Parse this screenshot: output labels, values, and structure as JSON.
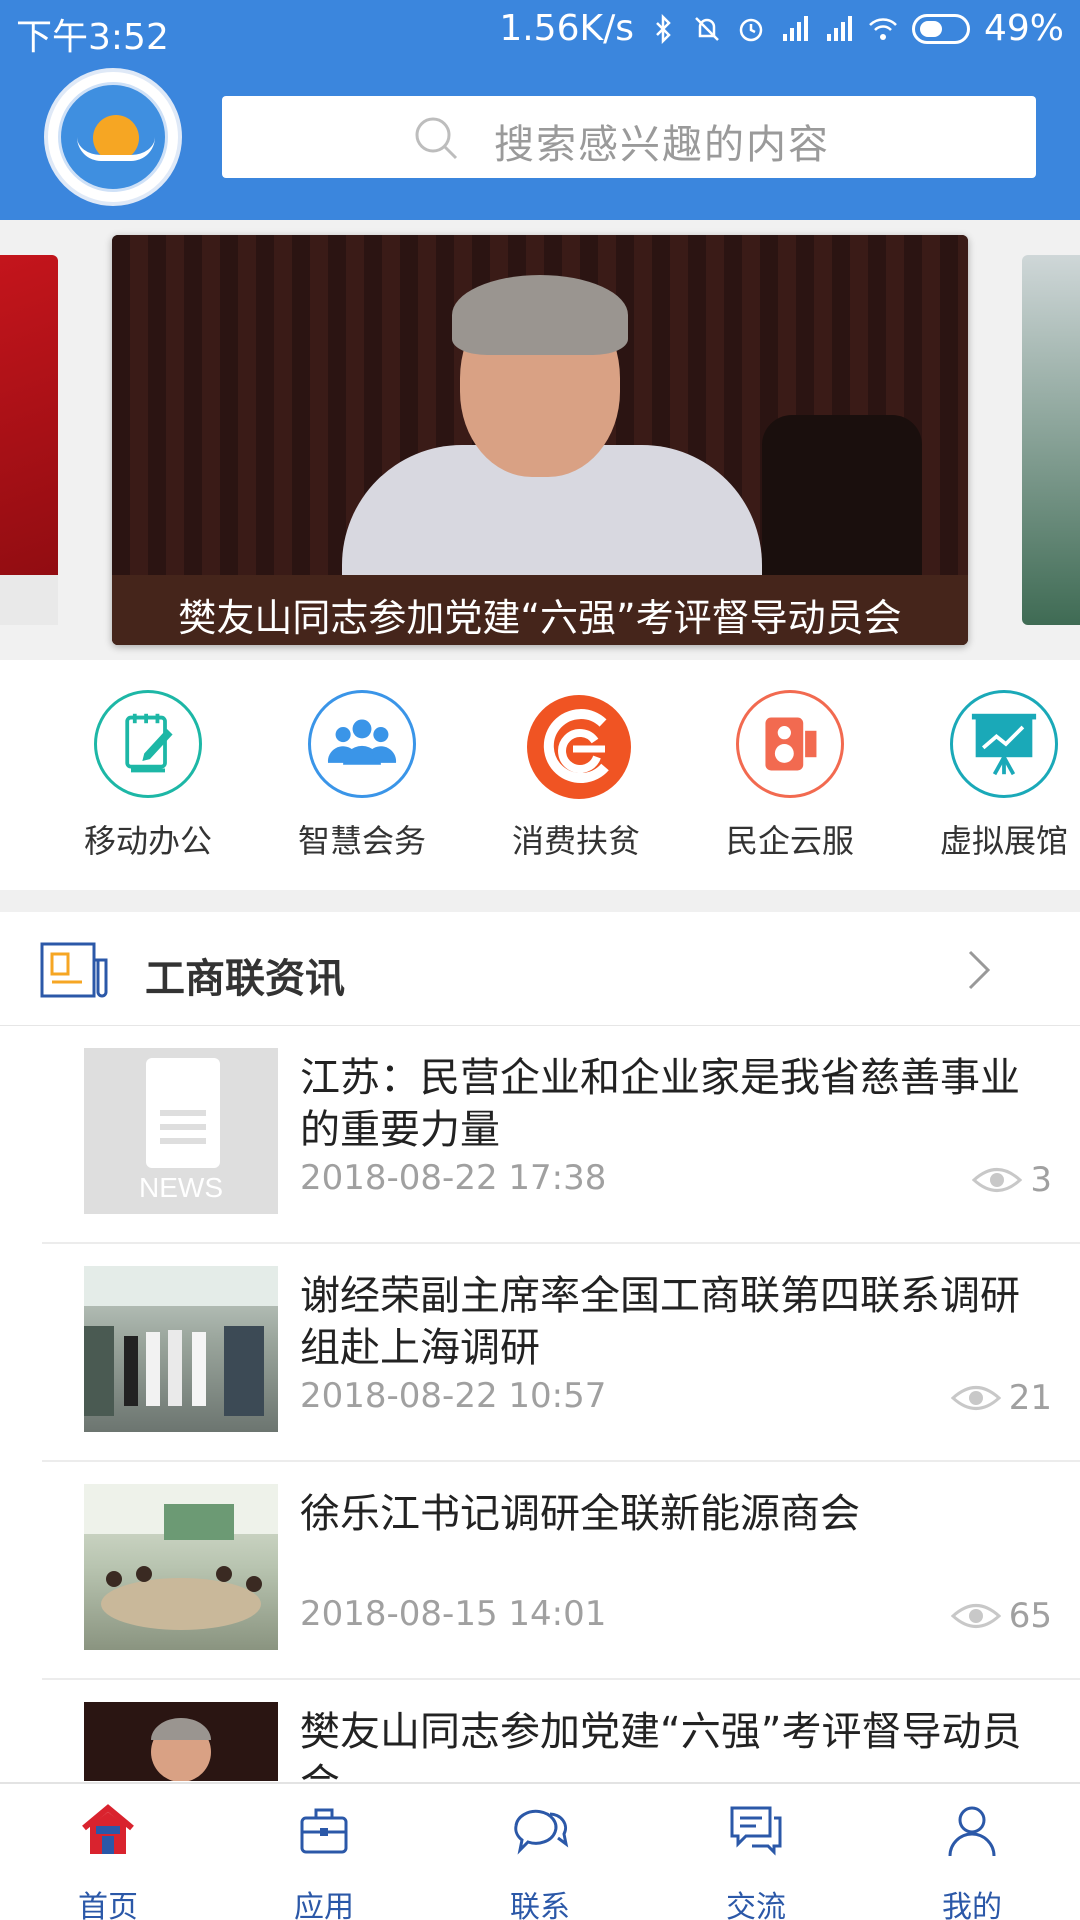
{
  "status_bar": {
    "time": "下午3:52",
    "network_speed": "1.56K/s",
    "battery": "49%"
  },
  "search": {
    "placeholder": "搜索感兴趣的内容"
  },
  "banner": {
    "caption": "樊友山同志参加党建“六强”考评督导动员会"
  },
  "quick_entries": [
    {
      "label": "移动办公",
      "icon": "notepad-pen-icon",
      "color": "#1db7a6"
    },
    {
      "label": "智慧会务",
      "icon": "people-group-icon",
      "color": "#3a95e8"
    },
    {
      "label": "消费扶贫",
      "icon": "c-logo-icon",
      "color": "#f05423"
    },
    {
      "label": "民企云服",
      "icon": "speaker-icon",
      "color": "#f26a50"
    },
    {
      "label": "虚拟展馆",
      "icon": "presentation-board-icon",
      "color": "#1aa9b8"
    }
  ],
  "news_section": {
    "title": "工商联资讯",
    "items": [
      {
        "title": "江苏：民营企业和企业家是我省慈善事业的重要力量",
        "date": "2018-08-22 17:38",
        "views": "3",
        "thumb_label": "NEWS"
      },
      {
        "title": "谢经荣副主席率全国工商联第四联系调研组赴上海调研",
        "date": "2018-08-22 10:57",
        "views": "21"
      },
      {
        "title": "徐乐江书记调研全联新能源商会",
        "date": "2018-08-15 14:01",
        "views": "65"
      },
      {
        "title": "樊友山同志参加党建“六强”考评督导动员会",
        "date": "",
        "views": ""
      }
    ]
  },
  "bottom_nav": {
    "tabs": [
      {
        "label": "首页",
        "icon": "home-icon",
        "active": true
      },
      {
        "label": "应用",
        "icon": "briefcase-icon",
        "active": false
      },
      {
        "label": "联系",
        "icon": "chat-bubbles-icon",
        "active": false
      },
      {
        "label": "交流",
        "icon": "message-board-icon",
        "active": false
      },
      {
        "label": "我的",
        "icon": "user-icon",
        "active": false
      }
    ]
  },
  "colors": {
    "header": "#3b86dd",
    "nav_text": "#2b58a8",
    "home_icon": "#d9232e"
  }
}
